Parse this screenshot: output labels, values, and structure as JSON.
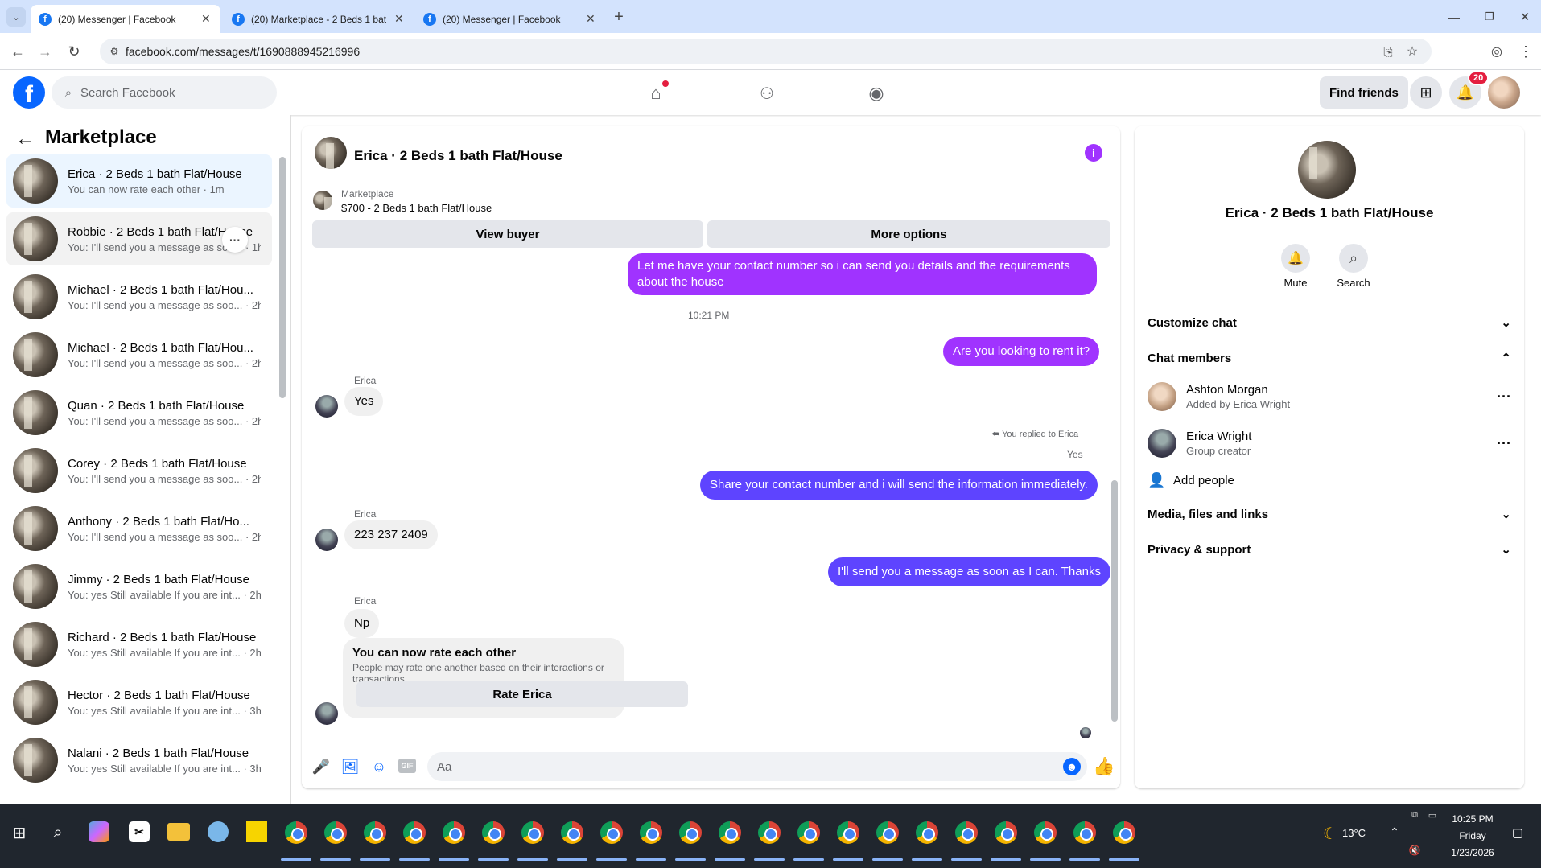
{
  "browser": {
    "tabs": [
      {
        "title": "(20) Messenger | Facebook",
        "active": true
      },
      {
        "title": "(20) Marketplace - 2 Beds 1 bat",
        "active": false
      },
      {
        "title": "(20) Messenger | Facebook",
        "active": false
      }
    ],
    "url": "facebook.com/messages/t/1690888945216996"
  },
  "fb": {
    "search_placeholder": "Search Facebook",
    "find_friends": "Find friends",
    "notif_count": "20"
  },
  "left": {
    "title": "Marketplace",
    "conversations": [
      {
        "name": "Erica · 2 Beds 1 bath Flat/House",
        "sub": "You can now rate each other · 1m"
      },
      {
        "name": "Robbie · 2 Beds 1 bath Flat/House",
        "sub": "You: I'll send you a message as soo... · 1h"
      },
      {
        "name": "Michael · 2 Beds 1 bath Flat/Hou...",
        "sub": "You: I'll send you a message as soo... · 2h"
      },
      {
        "name": "Michael · 2 Beds 1 bath Flat/Hou...",
        "sub": "You: I'll send you a message as soo... · 2h"
      },
      {
        "name": "Quan · 2 Beds 1 bath Flat/House",
        "sub": "You: I'll send you a message as soo... · 2h"
      },
      {
        "name": "Corey · 2 Beds 1 bath Flat/House",
        "sub": "You: I'll send you a message as soo... · 2h"
      },
      {
        "name": "Anthony · 2 Beds 1 bath Flat/Ho...",
        "sub": "You: I'll send you a message as soo... · 2h"
      },
      {
        "name": "Jimmy · 2 Beds 1 bath Flat/House",
        "sub": "You: yes Still available If you are int... · 2h"
      },
      {
        "name": "Richard · 2 Beds 1 bath Flat/House",
        "sub": "You: yes Still available If you are int... · 2h"
      },
      {
        "name": "Hector · 2 Beds 1 bath Flat/House",
        "sub": "You: yes Still available If you are int... · 3h"
      },
      {
        "name": "Nalani · 2 Beds 1 bath Flat/House",
        "sub": "You: yes Still available If you are int... · 3h"
      }
    ]
  },
  "chat": {
    "title": "Erica · 2 Beds 1 bath Flat/House",
    "listing_label": "Marketplace",
    "listing_title": "$700 - 2 Beds 1 bath Flat/House",
    "view_buyer": "View buyer",
    "more_options": "More options",
    "msg_contact": "Let me have your contact number so i can send you details and the requirements about the house",
    "time": "10:21 PM",
    "msg_rent": "Are you looking to rent it?",
    "sender": "Erica",
    "reply_yes": "Yes",
    "replied_to": "You replied to Erica",
    "quoted": "Yes",
    "msg_share": "Share your contact number and i will send the information immediately.",
    "reply_number": "223 237 2409",
    "msg_send": "I'll send you a message as soon as I can. Thanks",
    "reply_np": "Np",
    "rate_title": "You can now rate each other",
    "rate_sub": "People may rate one another based on their interactions or transactions.",
    "rate_btn": "Rate Erica",
    "composer_placeholder": "Aa"
  },
  "right": {
    "title": "Erica · 2 Beds 1 bath Flat/House",
    "mute": "Mute",
    "search": "Search",
    "customize": "Customize chat",
    "members_header": "Chat members",
    "members": [
      {
        "name": "Ashton Morgan",
        "sub": "Added by Erica Wright"
      },
      {
        "name": "Erica Wright",
        "sub": "Group creator"
      }
    ],
    "add_people": "Add people",
    "media": "Media, files and links",
    "privacy": "Privacy & support"
  },
  "taskbar": {
    "weather": "13°C",
    "time": "10:25 PM",
    "day": "Friday",
    "date": "1/23/2026"
  },
  "colors": {
    "fb_blue": "#0866ff",
    "bubble_purple": "#a033ff",
    "bubble_indigo": "#5e44ff"
  }
}
